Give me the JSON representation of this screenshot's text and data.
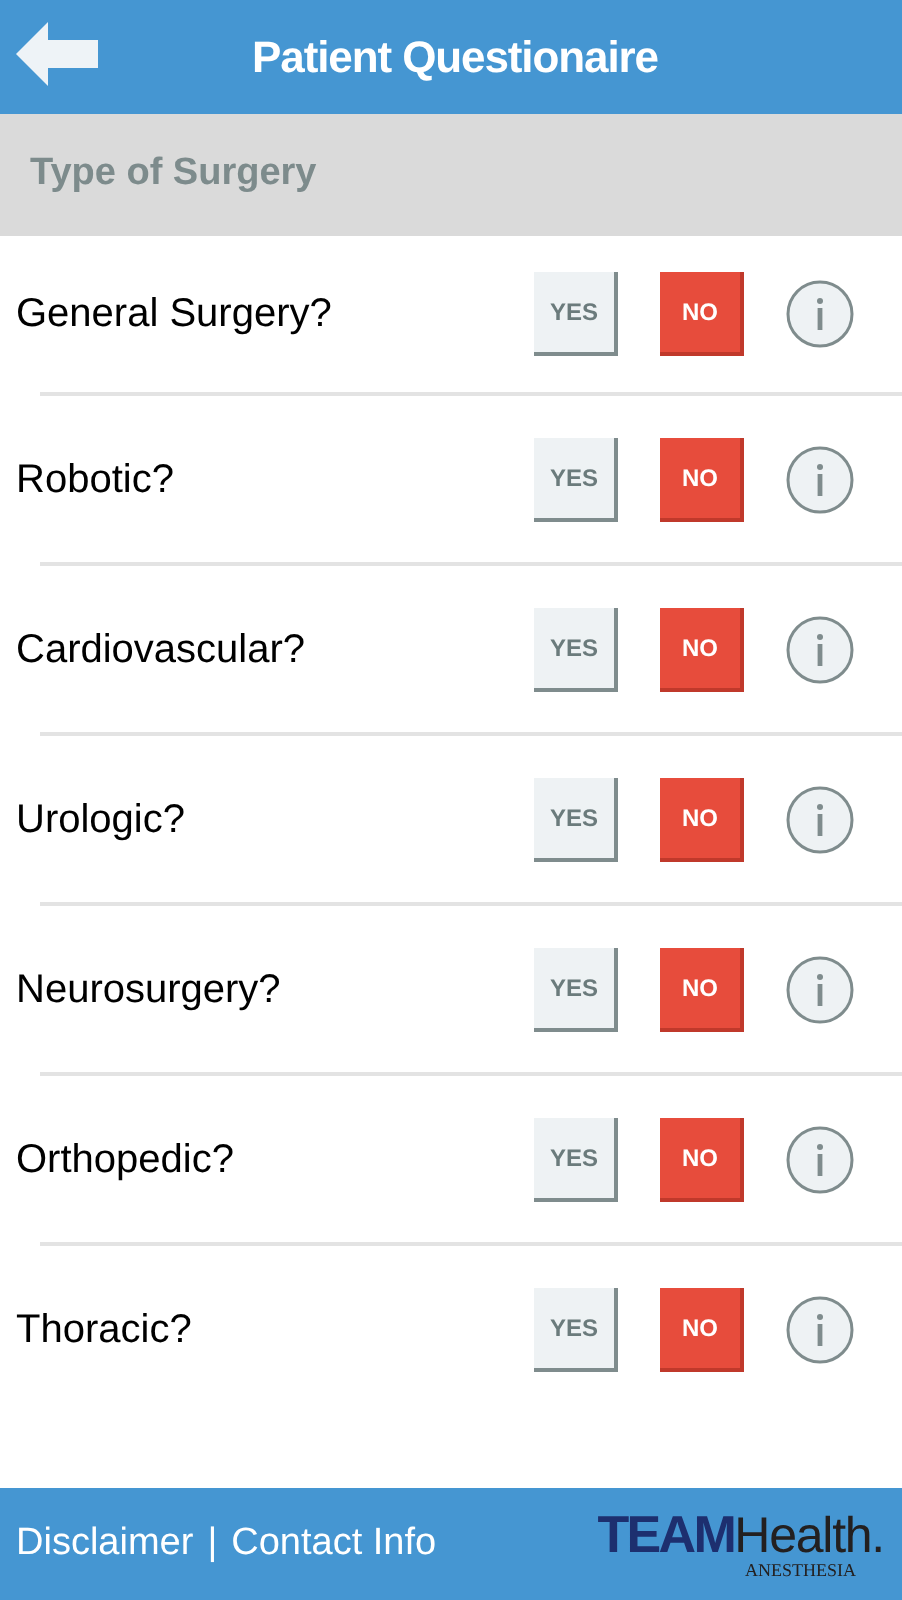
{
  "header": {
    "title": "Patient Questionaire"
  },
  "section": {
    "title": "Type of Surgery"
  },
  "questions": [
    {
      "label": "General Surgery?",
      "options": [
        {
          "label": "YES",
          "selected": false
        },
        {
          "label": "NO",
          "selected": true
        }
      ]
    },
    {
      "label": "Robotic?",
      "options": [
        {
          "label": "YES",
          "selected": false
        },
        {
          "label": "NO",
          "selected": true
        }
      ]
    },
    {
      "label": "Cardiovascular?",
      "options": [
        {
          "label": "YES",
          "selected": false
        },
        {
          "label": "NO",
          "selected": true
        }
      ]
    },
    {
      "label": "Urologic?",
      "options": [
        {
          "label": "YES",
          "selected": false
        },
        {
          "label": "NO",
          "selected": true
        }
      ]
    },
    {
      "label": "Neurosurgery?",
      "options": [
        {
          "label": "YES",
          "selected": false
        },
        {
          "label": "NO",
          "selected": true
        }
      ]
    },
    {
      "label": "Orthopedic?",
      "options": [
        {
          "label": "YES",
          "selected": false
        },
        {
          "label": "NO",
          "selected": true
        }
      ]
    },
    {
      "label": "Thoracic?",
      "options": [
        {
          "label": "YES",
          "selected": false
        },
        {
          "label": "NO",
          "selected": true
        }
      ]
    }
  ],
  "footer": {
    "links": [
      "Disclaimer",
      "Contact Info"
    ],
    "separator": "|",
    "logo": {
      "bold": "TEAM",
      "light": "Health.",
      "subtitle": "ANESTHESIA"
    }
  }
}
